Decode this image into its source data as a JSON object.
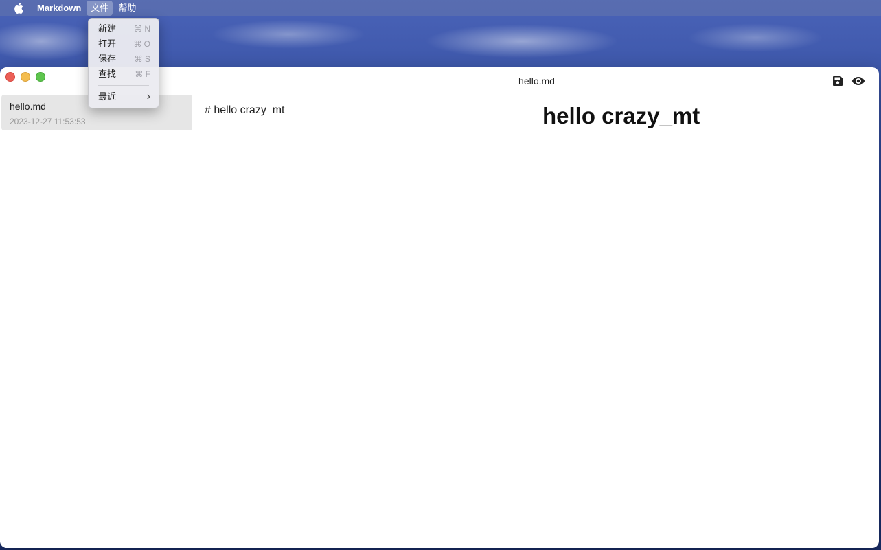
{
  "menubar": {
    "app_name": "Markdown",
    "menus": [
      "文件",
      "帮助"
    ]
  },
  "file_menu": {
    "items": [
      {
        "label": "新建",
        "shortcut": "⌘ N"
      },
      {
        "label": "打开",
        "shortcut": "⌘ O"
      },
      {
        "label": "保存",
        "shortcut": "⌘ S"
      },
      {
        "label": "查找",
        "shortcut": "⌘ F"
      }
    ],
    "recent_label": "最近",
    "recent_arrow": "›"
  },
  "sidebar": {
    "files": [
      {
        "name": "hello.md",
        "date": "2023-12-27 11:53:53"
      }
    ]
  },
  "document": {
    "title": "hello.md",
    "source": "# hello crazy_mt",
    "preview_heading": "hello crazy_mt"
  },
  "icons": {
    "save": "save-icon",
    "preview": "eye-icon",
    "apple": "apple-icon"
  }
}
